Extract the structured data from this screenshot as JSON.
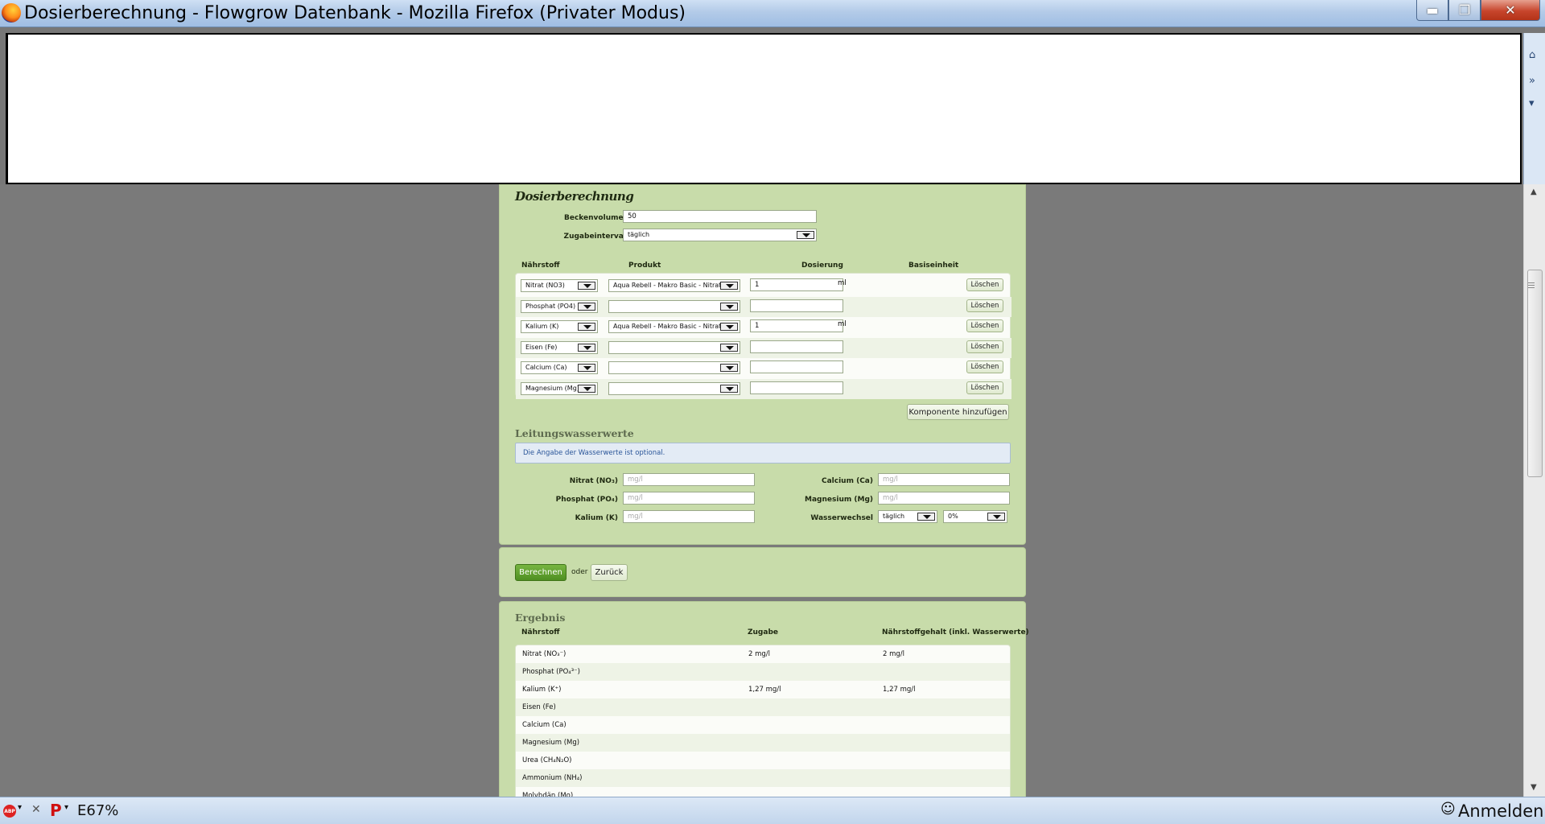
{
  "window": {
    "title": "Dosierberechnung - Flowgrow Datenbank - Mozilla Firefox (Privater Modus)",
    "min_glyph": "▬",
    "max_glyph": "❐",
    "close_glyph": "✕"
  },
  "sidestrip": {
    "home": "⌂",
    "more": "»",
    "down": "▾"
  },
  "form": {
    "heading": "Dosierberechnung",
    "beckenvolumen_label": "Beckenvolumen",
    "beckenvolumen_value": "50",
    "zugabeintervall_label": "Zugabeintervall",
    "zugabeintervall_value": "täglich",
    "columns": {
      "naehrstoff": "Nährstoff",
      "produkt": "Produkt",
      "dosierung": "Dosierung",
      "basiseinheit": "Basiseinheit"
    },
    "delete_label": "Löschen",
    "rows": [
      {
        "naehrstoff": "Nitrat (NO3)",
        "produkt": "Aqua Rebell - Makro Basic - Nitrat",
        "dosierung": "1",
        "einheit": "ml"
      },
      {
        "naehrstoff": "Phosphat (PO4)",
        "produkt": "",
        "dosierung": "",
        "einheit": ""
      },
      {
        "naehrstoff": "Kalium (K)",
        "produkt": "Aqua Rebell - Makro Basic - Nitrat",
        "dosierung": "1",
        "einheit": "ml"
      },
      {
        "naehrstoff": "Eisen (Fe)",
        "produkt": "",
        "dosierung": "",
        "einheit": ""
      },
      {
        "naehrstoff": "Calcium (Ca)",
        "produkt": "",
        "dosierung": "",
        "einheit": ""
      },
      {
        "naehrstoff": "Magnesium (Mg)",
        "produkt": "",
        "dosierung": "",
        "einheit": ""
      }
    ],
    "add_component": "Komponente hinzufügen"
  },
  "water": {
    "heading": "Leitungswasserwerte",
    "info": "Die Angabe der Wasserwerte ist optional.",
    "unit_placeholder": "mg/l",
    "nitrat_label": "Nitrat (NO₃)",
    "phosphat_label": "Phosphat (PO₄)",
    "kalium_label": "Kalium (K)",
    "calcium_label": "Calcium (Ca)",
    "magnesium_label": "Magnesium (Mg)",
    "wasserwechsel_label": "Wasserwechsel",
    "wasserwechsel_interval": "täglich",
    "wasserwechsel_percent": "0%"
  },
  "actions": {
    "calculate": "Berechnen",
    "or": "oder",
    "back": "Zurück"
  },
  "result": {
    "heading": "Ergebnis",
    "columns": {
      "naehrstoff": "Nährstoff",
      "zugabe": "Zugabe",
      "gehalt": "Nährstoffgehalt (inkl. Wasserwerte)"
    },
    "rows": [
      {
        "name": "Nitrat (NO₃⁻)",
        "zugabe": "2 mg/l",
        "gehalt": "2 mg/l"
      },
      {
        "name": "Phosphat (PO₄³⁻)",
        "zugabe": "",
        "gehalt": ""
      },
      {
        "name": "Kalium (K⁺)",
        "zugabe": "1,27 mg/l",
        "gehalt": "1,27 mg/l"
      },
      {
        "name": "Eisen (Fe)",
        "zugabe": "",
        "gehalt": ""
      },
      {
        "name": "Calcium (Ca)",
        "zugabe": "",
        "gehalt": ""
      },
      {
        "name": "Magnesium (Mg)",
        "zugabe": "",
        "gehalt": ""
      },
      {
        "name": "Urea (CH₄N₂O)",
        "zugabe": "",
        "gehalt": ""
      },
      {
        "name": "Ammonium (NH₄)",
        "zugabe": "",
        "gehalt": ""
      },
      {
        "name": "Molybdän (Mo)",
        "zugabe": "",
        "gehalt": ""
      }
    ]
  },
  "status": {
    "abp": "ABP",
    "zoom": "E67%",
    "signin": "Anmelden",
    "close": "✕"
  }
}
